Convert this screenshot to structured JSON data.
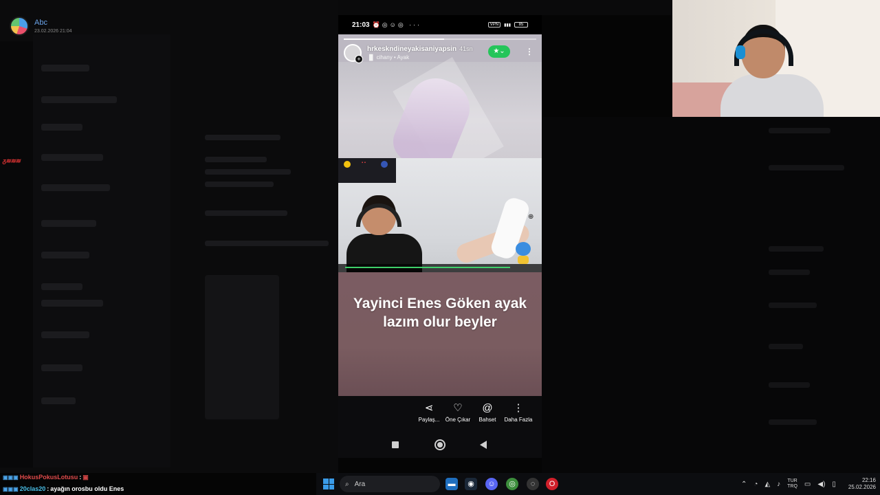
{
  "overlay": {
    "user_name": "Abc",
    "user_date": "23.02.2026 21:04"
  },
  "phone_status": {
    "time": "21:03",
    "battery": "85"
  },
  "story": {
    "username": "hrkeskndineyakisaniyapsin",
    "posted_ago": "41sn",
    "music": "cihany • Ayak",
    "caption_line1": "Yayinci Enes Göken ayak",
    "caption_line2": "lazım olur beyler"
  },
  "actions": [
    {
      "label": "Paylaş...",
      "icon": "share-icon"
    },
    {
      "label": "Öne Çıkar",
      "icon": "highlight-heart-icon"
    },
    {
      "label": "Bahset",
      "icon": "mention-icon"
    },
    {
      "label": "Daha Fazla",
      "icon": "more-vertical-icon"
    }
  ],
  "chat": [
    {
      "user": "HokusPokusLotusu",
      "message": ""
    },
    {
      "user": "20clas20",
      "message": "ayağın orosbu oldu Enes"
    }
  ],
  "taskbar": {
    "search_placeholder": "Ara",
    "lang_top": "TUR",
    "lang_bottom": "TRQ",
    "time": "22:16",
    "date": "25.02.2026"
  },
  "colors": {
    "favorite_green": "#25c55a",
    "caption_bg": "#7b5c62",
    "accent_blue": "#3a9be8"
  }
}
